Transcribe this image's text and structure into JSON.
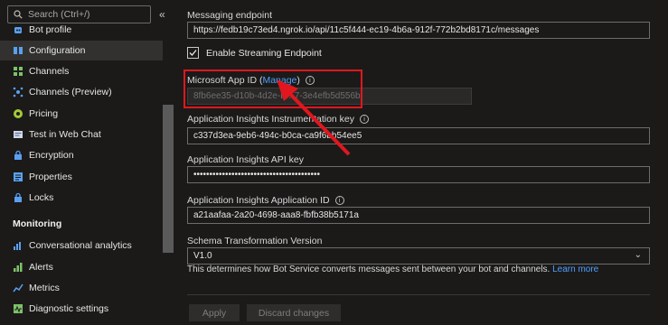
{
  "sidebar": {
    "search_placeholder": "Search (Ctrl+/)",
    "collapse_label": "«",
    "items": [
      {
        "label": "Bot profile",
        "icon": "bot-icon"
      },
      {
        "label": "Configuration",
        "icon": "config-icon"
      },
      {
        "label": "Channels",
        "icon": "channels-icon"
      },
      {
        "label": "Channels (Preview)",
        "icon": "channels-preview-icon"
      },
      {
        "label": "Pricing",
        "icon": "pricing-icon"
      },
      {
        "label": "Test in Web Chat",
        "icon": "web-chat-icon"
      },
      {
        "label": "Encryption",
        "icon": "lock-icon"
      },
      {
        "label": "Properties",
        "icon": "properties-icon"
      },
      {
        "label": "Locks",
        "icon": "lock-icon"
      }
    ],
    "monitoring_heading": "Monitoring",
    "monitoring_items": [
      {
        "label": "Conversational analytics",
        "icon": "analytics-icon"
      },
      {
        "label": "Alerts",
        "icon": "alerts-icon"
      },
      {
        "label": "Metrics",
        "icon": "metrics-icon"
      },
      {
        "label": "Diagnostic settings",
        "icon": "diagnostic-icon"
      }
    ]
  },
  "form": {
    "messaging_endpoint_label": "Messaging endpoint",
    "messaging_endpoint_value": "https://fedb19c73ed4.ngrok.io/api/11c5f444-ec19-4b6a-912f-772b2bd8171c/messages",
    "streaming_label": "Enable Streaming Endpoint",
    "app_id_label": "Microsoft App ID",
    "manage_link": "Manage",
    "app_id_value": "8fb6ee35-d10b-4d2e-b…7-3e4efb5d556b",
    "instrumentation_label": "Application Insights Instrumentation key",
    "instrumentation_value": "c337d3ea-9eb6-494c-b0ca-ca9f6bb54ee5",
    "api_key_label": "Application Insights API key",
    "api_key_value": "••••••••••••••••••••••••••••••••••••••••",
    "app_insights_id_label": "Application Insights Application ID",
    "app_insights_id_value": "a21aafaa-2a20-4698-aaa8-fbfb38b5171a",
    "schema_label": "Schema Transformation Version",
    "schema_value": "V1.0",
    "helper_text": "This determines how Bot Service converts messages sent between your bot and channels.",
    "learn_more": "Learn more",
    "apply_label": "Apply",
    "discard_label": "Discard changes"
  },
  "colors": {
    "accent_link": "#4ea1ff",
    "highlight_box": "#e0171e"
  }
}
